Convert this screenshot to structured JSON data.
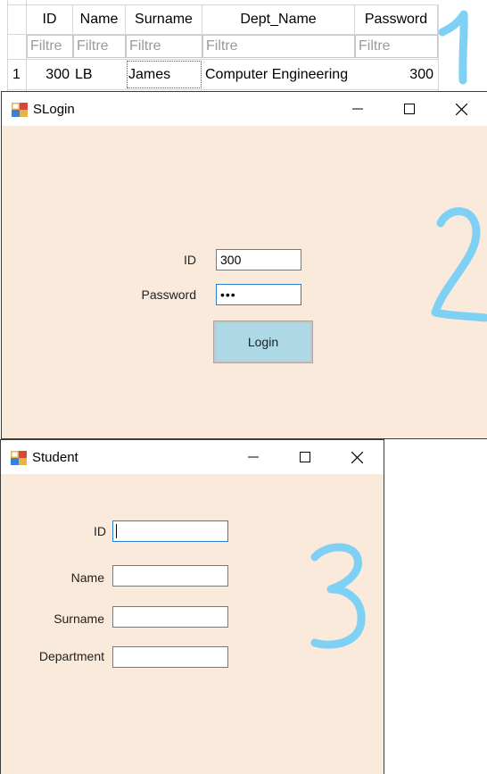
{
  "table": {
    "columns": [
      "ID",
      "Name",
      "Surname",
      "Dept_Name",
      "Password"
    ],
    "filter_placeholder": "Filtre",
    "rows": [
      {
        "row_num": "1",
        "cells": [
          "300",
          "LB",
          "James",
          "Computer Engineering",
          "300"
        ]
      }
    ]
  },
  "login_window": {
    "title": "SLogin",
    "id_label": "ID",
    "id_value": "300",
    "password_label": "Password",
    "password_value": "•••",
    "login_button": "Login"
  },
  "student_window": {
    "title": "Student",
    "id_label": "ID",
    "id_value": "",
    "name_label": "Name",
    "name_value": "",
    "surname_label": "Surname",
    "surname_value": "",
    "department_label": "Department",
    "department_value": ""
  },
  "annotations": [
    "1",
    "2",
    "3"
  ],
  "colors": {
    "form_background": "#faeadb",
    "button_background": "#add8e6",
    "annotation": "#7fd0f5"
  }
}
